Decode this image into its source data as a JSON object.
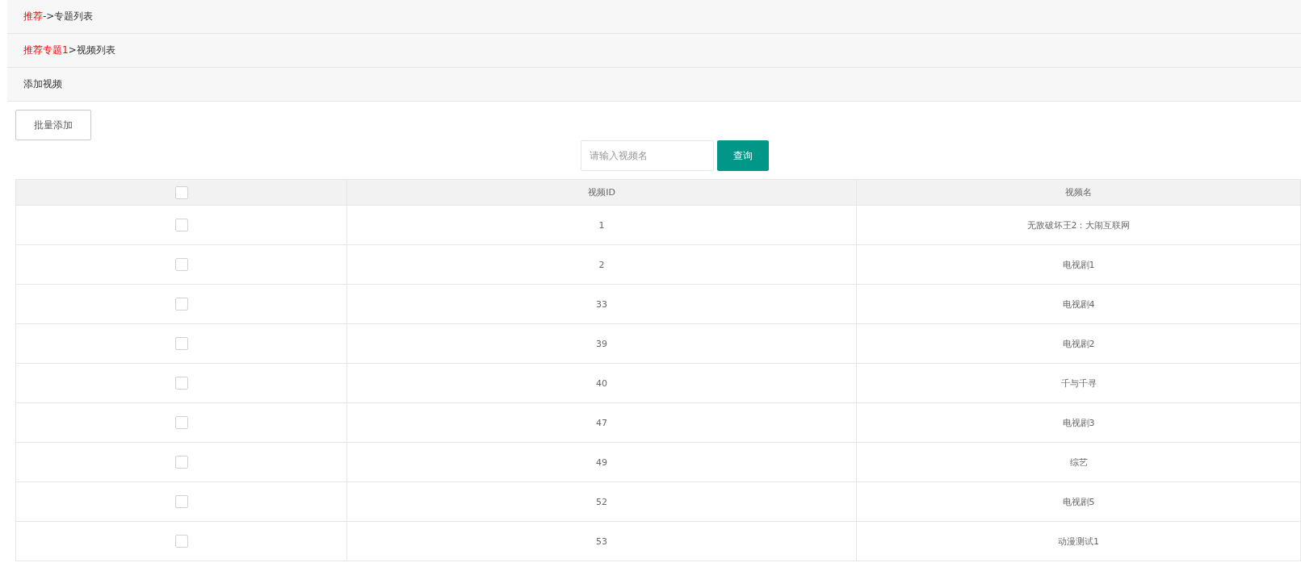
{
  "breadcrumbs": [
    {
      "link": "推荐",
      "rest": "->专题列表"
    },
    {
      "link": "推荐专题1",
      "rest": ">视频列表"
    }
  ],
  "section_title": "添加视频",
  "batch_button": "批量添加",
  "search": {
    "placeholder": "请输入视频名",
    "button": "查询"
  },
  "table": {
    "select_all_checked": false,
    "columns": [
      "视频ID",
      "视频名"
    ],
    "rows": [
      {
        "checked": false,
        "id": "1",
        "name": "无敌破坏王2：大闹互联网"
      },
      {
        "checked": false,
        "id": "2",
        "name": "电视剧1"
      },
      {
        "checked": false,
        "id": "33",
        "name": "电视剧4"
      },
      {
        "checked": false,
        "id": "39",
        "name": "电视剧2"
      },
      {
        "checked": false,
        "id": "40",
        "name": "千与千寻"
      },
      {
        "checked": false,
        "id": "47",
        "name": "电视剧3"
      },
      {
        "checked": false,
        "id": "49",
        "name": "综艺"
      },
      {
        "checked": false,
        "id": "52",
        "name": "电视剧5"
      },
      {
        "checked": false,
        "id": "53",
        "name": "动漫测试1"
      }
    ]
  }
}
